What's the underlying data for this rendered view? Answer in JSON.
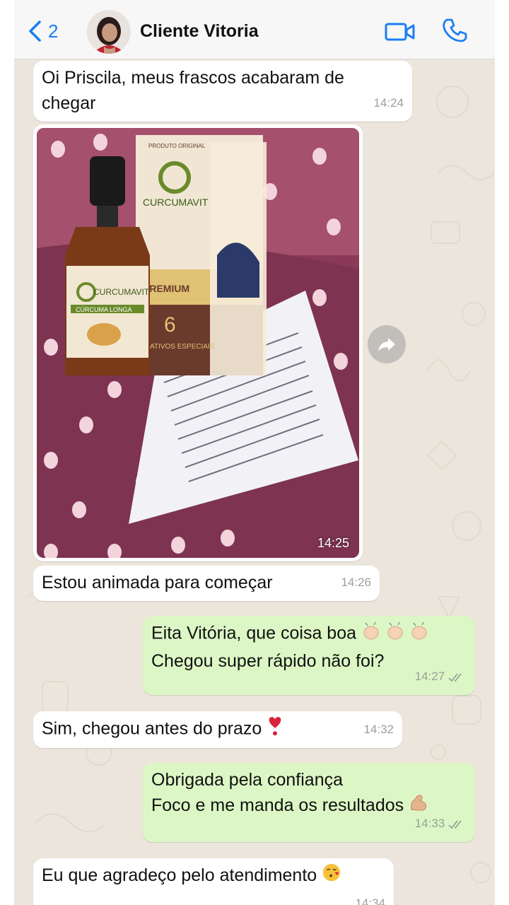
{
  "header": {
    "back_count": "2",
    "contact_name": "Cliente Vitoria"
  },
  "colors": {
    "accent": "#1a7ef2",
    "incoming_bubble": "#ffffff",
    "outgoing_bubble": "#dcf7c5",
    "chat_background": "#ece5dc"
  },
  "messages": [
    {
      "dir": "in",
      "text_lines": [
        "Oi Priscila, meus frascos acabaram de",
        "chegar"
      ],
      "time": "14:24"
    },
    {
      "dir": "in",
      "type": "image",
      "time": "14:25",
      "product": {
        "brand": "CURCUMAVIT",
        "badge": "PRODUTO ORIGINAL",
        "formula": "FÓRMULA PREMIUM",
        "count": "6",
        "actives": "ATIVOS ESPECIAIS",
        "label": "CÚRCUMA LONGA"
      }
    },
    {
      "dir": "in",
      "text_lines": [
        "Estou animada para começar"
      ],
      "time": "14:26"
    },
    {
      "dir": "out",
      "text_lines": [
        "Eita Vitória, que coisa boa",
        "Chegou super rápido não foi?"
      ],
      "time": "14:27",
      "emoji": "clapping-hands"
    },
    {
      "dir": "in",
      "text_lines": [
        "Sim, chegou antes do prazo"
      ],
      "time": "14:32",
      "emoji": "heart-exclamation"
    },
    {
      "dir": "out",
      "text_lines": [
        "Obrigada pela confiança",
        "Foco e me manda os resultados"
      ],
      "time": "14:33",
      "emoji": "flexed-biceps"
    },
    {
      "dir": "in",
      "text_lines": [
        "Eu que agradeço pelo atendimento"
      ],
      "time": "14:34",
      "emoji": "face-blowing-kiss"
    }
  ]
}
